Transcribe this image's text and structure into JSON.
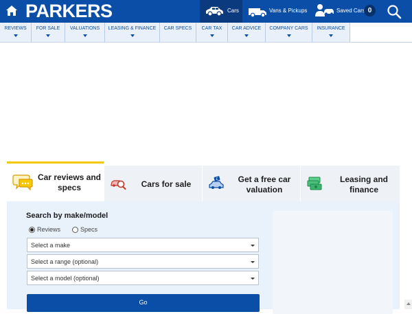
{
  "header": {
    "home_icon": "home-icon",
    "logo_text": "PARKERS",
    "nav": [
      {
        "label": "Cars",
        "icon": "car-icon",
        "active": true
      },
      {
        "label": "Vans & Pickups",
        "icon": "van-icon",
        "active": false
      }
    ],
    "saved": {
      "label": "Saved Cars",
      "count": "0",
      "icon": "saved-car-icon"
    },
    "search_icon": "search-icon"
  },
  "subnav": {
    "items": [
      {
        "label": "REVIEWS",
        "has_menu": true
      },
      {
        "label": "FOR SALE",
        "has_menu": true
      },
      {
        "label": "VALUATIONS",
        "has_menu": true
      },
      {
        "label": "LEASING & FINANCE",
        "has_menu": true
      },
      {
        "label": "CAR SPECS",
        "has_menu": false
      },
      {
        "label": "CAR TAX",
        "has_menu": true
      },
      {
        "label": "CAR ADVICE",
        "has_menu": true
      },
      {
        "label": "COMPANY CARS",
        "has_menu": true
      },
      {
        "label": "INSURANCE",
        "has_menu": true
      }
    ]
  },
  "tabs": [
    {
      "label_line1": "Car reviews and",
      "label_line2": "specs",
      "icon": "speech-bubble-icon",
      "active": true
    },
    {
      "label_line1": "Cars for sale",
      "label_line2": "",
      "icon": "car-search-icon",
      "active": false
    },
    {
      "label_line1": "Get a free car",
      "label_line2": "valuation",
      "icon": "car-price-tag-icon",
      "active": false
    },
    {
      "label_line1": "Leasing and",
      "label_line2": "finance",
      "icon": "cash-icon",
      "active": false
    }
  ],
  "search": {
    "title": "Search by make/model",
    "radios": [
      {
        "label": "Reviews",
        "checked": true
      },
      {
        "label": "Specs",
        "checked": false
      }
    ],
    "selects": [
      {
        "value": "Select a make"
      },
      {
        "value": "Select a range (optional)"
      },
      {
        "value": "Select a model (optional)"
      }
    ],
    "go_label": "Go"
  },
  "colors": {
    "brand_blue": "#0a4ea8",
    "active_nav": "#0c3a7e",
    "tab_accent": "#f5c800",
    "panel_bg": "#e9f1fb"
  }
}
